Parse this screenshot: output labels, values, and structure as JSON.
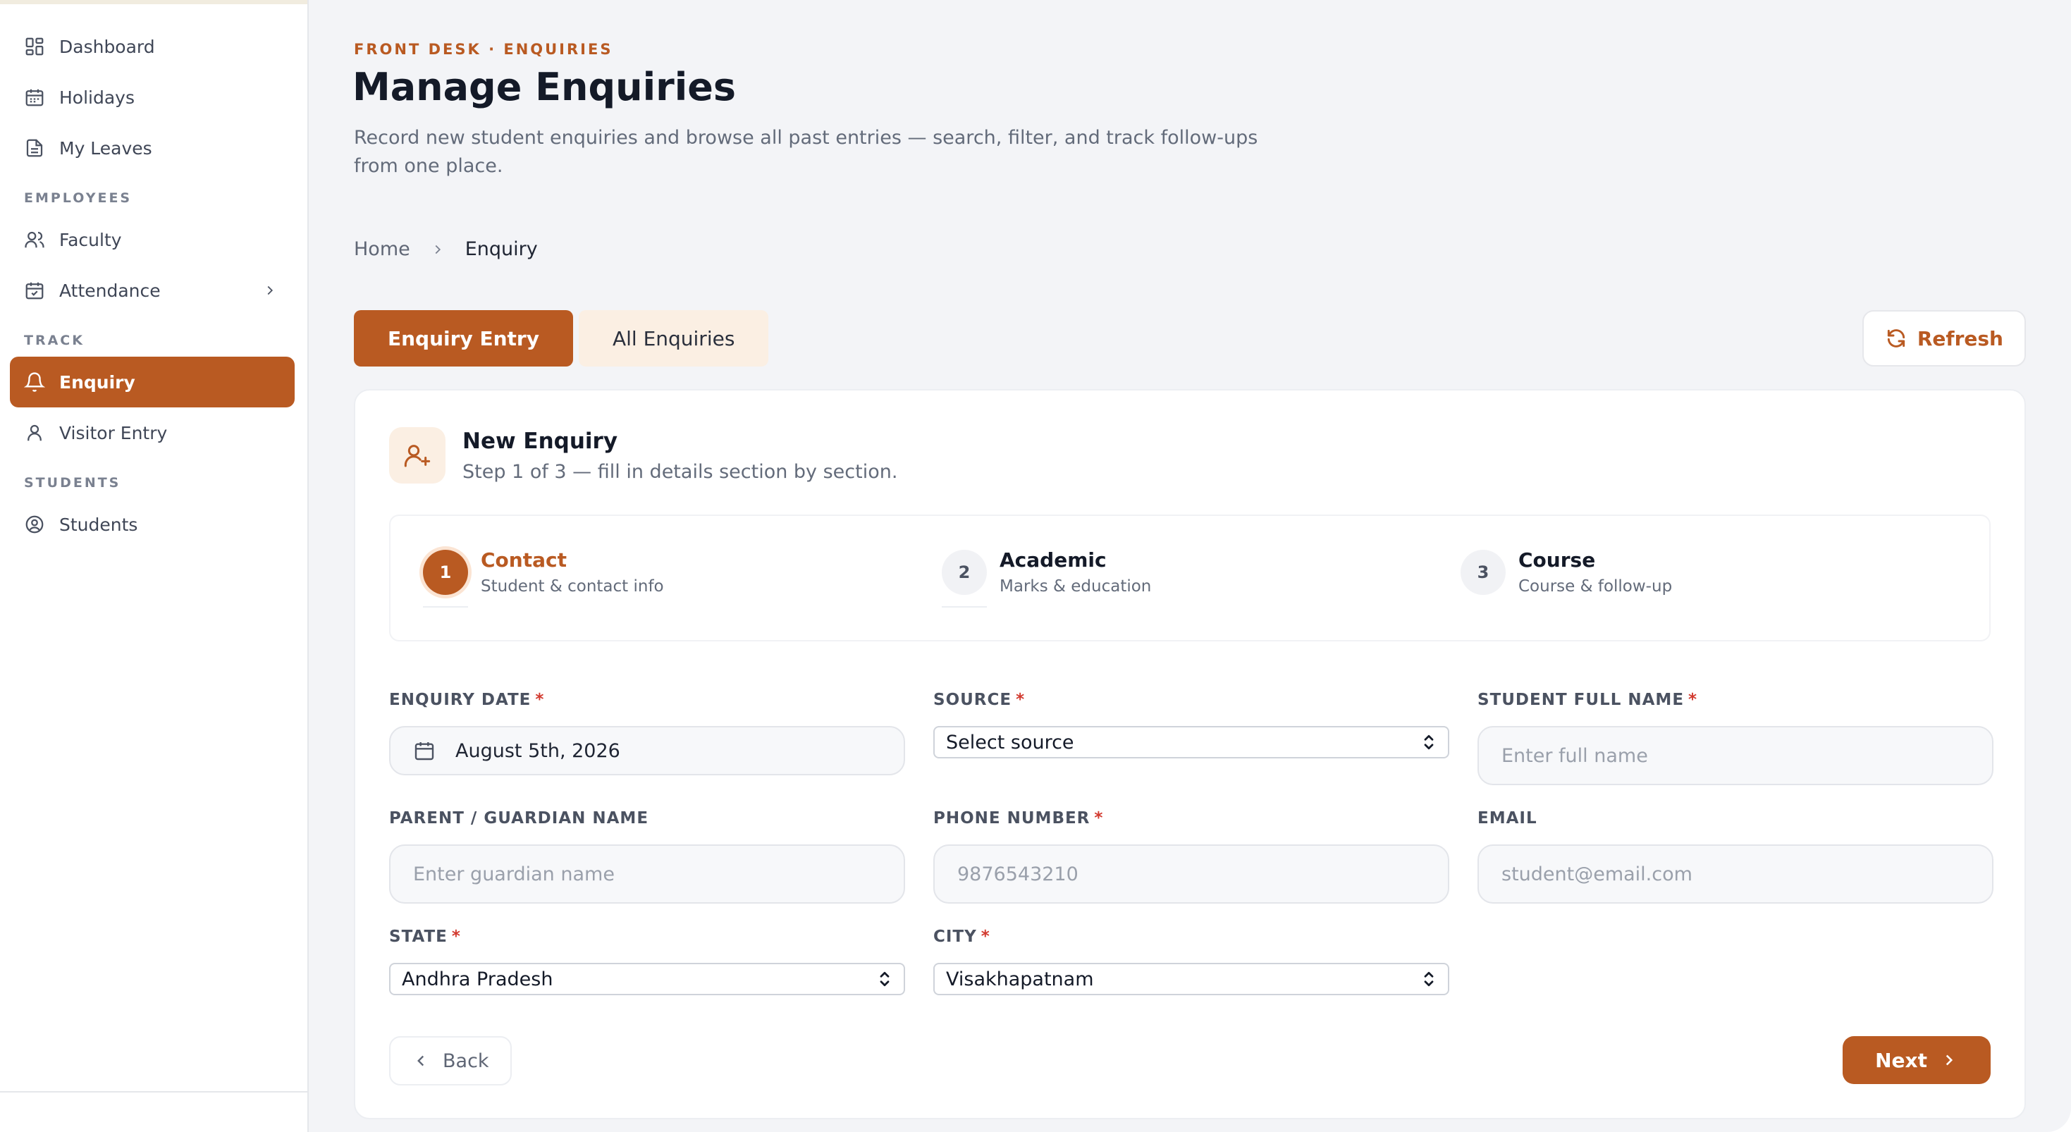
{
  "sidebar": {
    "items": [
      {
        "label": "Dashboard",
        "icon": "dashboard-icon"
      },
      {
        "label": "Holidays",
        "icon": "calendar-icon"
      },
      {
        "label": "My Leaves",
        "icon": "document-icon"
      }
    ],
    "sections": [
      {
        "title": "EMPLOYEES",
        "items": [
          {
            "label": "Faculty",
            "icon": "users-icon"
          },
          {
            "label": "Attendance",
            "icon": "calendar-check-icon"
          }
        ]
      },
      {
        "title": "TRACK",
        "items": [
          {
            "label": "Enquiry",
            "icon": "bell-icon"
          },
          {
            "label": "Visitor Entry",
            "icon": "user-icon"
          }
        ]
      },
      {
        "title": "STUDENTS",
        "items": [
          {
            "label": "Students",
            "icon": "user-circle-icon"
          }
        ]
      }
    ]
  },
  "header": {
    "eyebrow": "FRONT DESK · ENQUIRIES",
    "title": "Manage Enquiries",
    "subtitle": "Record new student enquiries and browse all past entries — search, filter, and track follow-ups from one place."
  },
  "breadcrumb": {
    "home": "Home",
    "current": "Enquiry"
  },
  "tabs": {
    "entry": "Enquiry Entry",
    "all": "All Enquiries"
  },
  "refresh_label": "Refresh",
  "card": {
    "title": "New Enquiry",
    "subtitle": "Step 1 of 3 — fill in details section by section."
  },
  "steps": [
    {
      "num": "1",
      "title": "Contact",
      "sub": "Student & contact info"
    },
    {
      "num": "2",
      "title": "Academic",
      "sub": "Marks & education"
    },
    {
      "num": "3",
      "title": "Course",
      "sub": "Course & follow-up"
    }
  ],
  "form": {
    "enquiry_date": {
      "label": "ENQUIRY DATE",
      "value": "August 5th, 2026"
    },
    "source": {
      "label": "SOURCE",
      "value": "Select source"
    },
    "student_name": {
      "label": "STUDENT FULL NAME",
      "placeholder": "Enter full name"
    },
    "guardian": {
      "label": "PARENT / GUARDIAN NAME",
      "placeholder": "Enter guardian name"
    },
    "phone": {
      "label": "PHONE NUMBER",
      "placeholder": "9876543210"
    },
    "email": {
      "label": "EMAIL",
      "placeholder": "student@email.com"
    },
    "state": {
      "label": "STATE",
      "value": "Andhra Pradesh"
    },
    "city": {
      "label": "CITY",
      "value": "Visakhapatnam"
    },
    "required_mark": "*"
  },
  "actions": {
    "back": "Back",
    "next": "Next"
  },
  "colors": {
    "accent": "#b95a22",
    "accent_soft": "#fbefe3",
    "required": "#d23a2f"
  }
}
